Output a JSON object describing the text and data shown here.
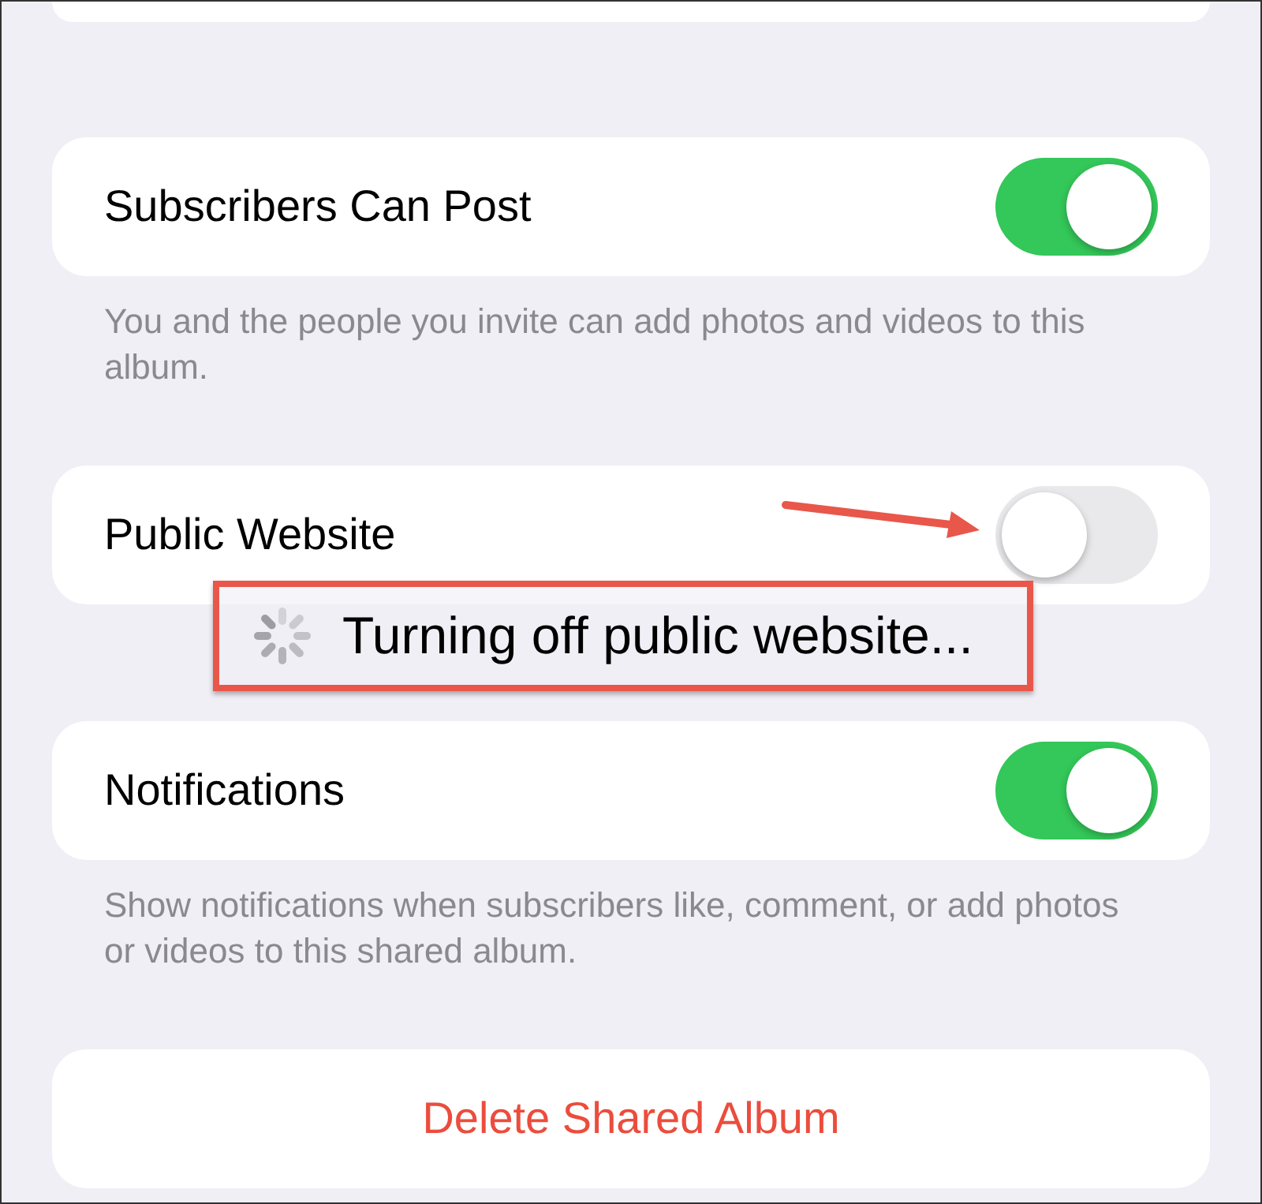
{
  "rows": [
    {
      "kind": "toggle",
      "label": "Subscribers Can Post",
      "on": true,
      "footer": "You and the people you invite can add photos and videos to this album."
    },
    {
      "kind": "toggle",
      "label": "Public Website",
      "on": false
    },
    {
      "kind": "toggle",
      "label": "Notifications",
      "on": true,
      "footer": "Show notifications when subscribers like, comment, or add photos or videos to this shared album."
    },
    {
      "kind": "destructive",
      "label": "Delete Shared Album"
    }
  ],
  "overlay": {
    "text": "Turning off public website..."
  }
}
